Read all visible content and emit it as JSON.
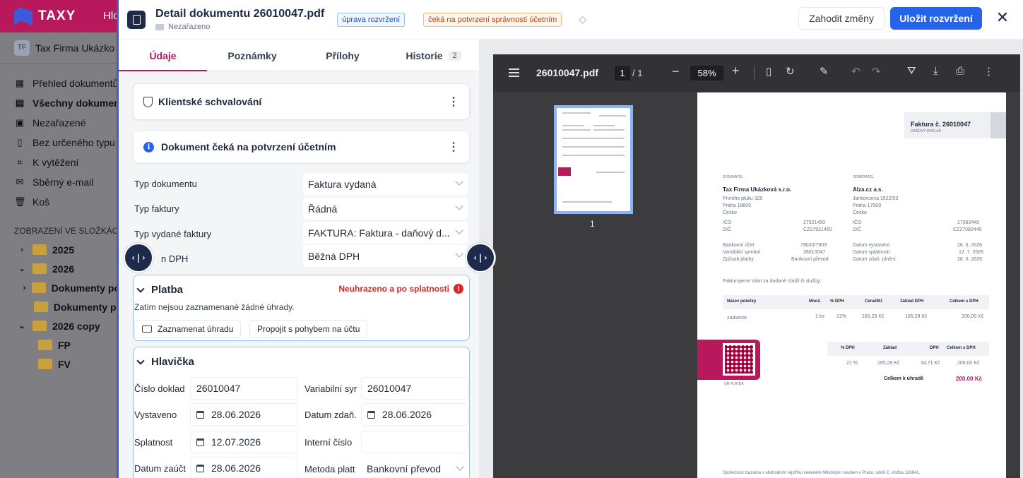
{
  "app": {
    "brand": "TAXY",
    "top_nav_partial": "Hlo",
    "company": "Tax Firma Ukázko",
    "company_initials": "TF",
    "nav_items": [
      {
        "label": "Přehled dokumentů",
        "icon": "grid-icon"
      },
      {
        "label": "Všechny dokumen",
        "icon": "document-icon"
      },
      {
        "label": "Nezařazené",
        "icon": "inbox-icon"
      },
      {
        "label": "Bez určeného typu",
        "icon": "clipboard-icon"
      },
      {
        "label": "K vytěžení",
        "icon": "scan-icon"
      },
      {
        "label": "Sběrný e-mail",
        "icon": "mail-icon"
      },
      {
        "label": "Koš",
        "icon": "trash-icon"
      }
    ],
    "folders_title": "ZOBRAZENÍ VE SLOŽKÁCH",
    "folders": [
      {
        "label": "2025",
        "chevron": "›"
      },
      {
        "label": "2026",
        "chevron": "⌄"
      },
      {
        "label": "Dokumenty po",
        "chevron": "›"
      },
      {
        "label": "Dokumenty př",
        "chevron": ""
      },
      {
        "label": "2026 copy",
        "chevron": "⌄"
      },
      {
        "label": "FP",
        "chevron": ""
      },
      {
        "label": "FV",
        "chevron": ""
      }
    ]
  },
  "header": {
    "title": "Detail dokumentu 26010047.pdf",
    "folder": "Nezařazeno",
    "badge_edit": "úprava rozvržení",
    "badge_status": "čeká na potvrzení správnosti účetním",
    "discard_label": "Zahodit změny",
    "save_label": "Uložit rozvržení",
    "close_symbol": "✕"
  },
  "tabs": [
    {
      "label": "Údaje",
      "active": true
    },
    {
      "label": "Poznámky"
    },
    {
      "label": "Přílohy"
    },
    {
      "label": "Historie",
      "count": "2"
    }
  ],
  "approval": {
    "title": "Klientské schvalování",
    "status_message": "Dokument čeká na potvrzení účetním"
  },
  "document_fields": {
    "type_label": "Typ dokumentu",
    "type_value": "Faktura vydaná",
    "invoice_type_label": "Typ faktury",
    "invoice_type_value": "Řádná",
    "issued_type_label": "Typ vydané faktury",
    "issued_type_value": "FAKTURA: Faktura - daňový d...",
    "vat_label_partial": "n DPH",
    "vat_value": "Běžná DPH"
  },
  "payment": {
    "title": "Platba",
    "status": "Neuhrazeno a po splatnosti",
    "empty_text": "Zatím nejsou zaznamenané žádné úhrady.",
    "record_label": "Zaznamenat úhradu",
    "link_label": "Propojit s pohybem na účtu"
  },
  "heading_section": {
    "title": "Hlavička",
    "doc_no_label": "Číslo doklad",
    "doc_no": "26010047",
    "var_symbol_label": "Variabilní syr",
    "var_symbol": "26010047",
    "issued_label": "Vystaveno",
    "issued": "28.06.2026",
    "tax_date_label": "Datum zdaň.",
    "tax_date": "28.06.2026",
    "due_label": "Splatnost",
    "due": "12.07.2026",
    "internal_label": "Interní číslo",
    "internal": "",
    "acc_date_label": "Datum zaúčt",
    "acc_date": "28.06.2026",
    "method_label": "Metoda platt",
    "method": "Bankovní převod"
  },
  "viewer": {
    "file_name": "26010047.pdf",
    "page": "1",
    "page_of": "/ 1",
    "zoom": "58%",
    "thumb_number": "1"
  },
  "pdf": {
    "heading": "Faktura č. 26010047",
    "heading_sub": "DAŇOVÝ DOKLAD",
    "supplier_caption": "DODAVATEL",
    "customer_caption": "ODBĚRATEL",
    "supplier_name": "Tax Firma Ukázková s.r.o.",
    "supplier_street": "Prvního pluku 320",
    "supplier_city": "Praha 18600",
    "supplier_country": "Česko",
    "customer_name": "Alza.cz a.s.",
    "customer_street": "Jankovcova 1522/53",
    "customer_city": "Praha 17000",
    "customer_country": "Česko",
    "ico_label": "IČO",
    "dic_label": "DIČ",
    "supplier_ico": "27921450",
    "supplier_dic": "CZ27921450",
    "customer_ico": "27082440",
    "customer_dic": "CZ27082440",
    "bank_label": "Bankovní účet",
    "bank": "79030/7903",
    "vs_label": "Variabilní symbol",
    "vs": "26010047",
    "pay_label": "Způsob platby",
    "pay": "Bankovní převod",
    "issued_label": "Datum vystavení",
    "issued": "28. 6. 2026",
    "due_label": "Datum splatnosti",
    "due": "12. 7. 2026",
    "tax_label": "Datum zdaň. plnění",
    "tax": "28. 6. 2026",
    "intro": "Fakturujeme Vám za dodané zboží či služby:",
    "col_item": "Název položky",
    "col_qty": "Množ.",
    "col_vat": "% DPH",
    "col_price": "Cena/MJ",
    "col_base": "Základ DPH",
    "col_total": "Celkem s DPH",
    "item_name": "zadveste",
    "item_qty": "1 ks",
    "item_vat": "21%",
    "item_price": "165,29 Kč",
    "item_base": "165,29 Kč",
    "item_total": "200,00 Kč",
    "sum_col_vat": "% DPH",
    "sum_col_base": "Základ",
    "sum_col_dph": "DPH",
    "sum_col_total": "Celkem s DPH",
    "sum_vat": "21 %",
    "sum_base": "165,29 Kč",
    "sum_dph": "34,71 Kč",
    "sum_total": "200,00 Kč",
    "to_pay_label": "Celkem k úhradě",
    "to_pay": "200,00 Kč",
    "qr_caption": "QR PLATBA",
    "footer": "Společnost zapsána v obchodním rejstříku vedeném Městským soudem v Praze, oddíl C, vložka 126641."
  },
  "colors": {
    "brand": "#b8185c",
    "primary": "#2563eb",
    "dark": "#1e2a4a",
    "danger": "#dc2626"
  }
}
